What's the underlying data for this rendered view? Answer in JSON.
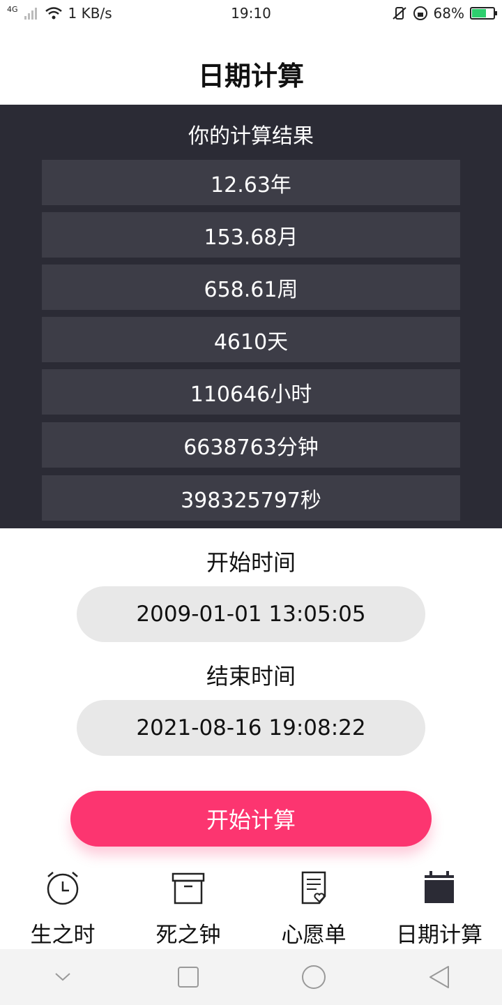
{
  "status_bar": {
    "network": "4G",
    "speed": "1 KB/s",
    "time": "19:10",
    "battery": "68%",
    "battery_level": 0.68
  },
  "page": {
    "title": "日期计算"
  },
  "results": {
    "heading": "你的计算结果",
    "items": [
      "12.63年",
      "153.68月",
      "658.61周",
      "4610天",
      "110646小时",
      "6638763分钟",
      "398325797秒"
    ]
  },
  "start": {
    "label": "开始时间",
    "value": "2009-01-01 13:05:05"
  },
  "end": {
    "label": "结束时间",
    "value": "2021-08-16 19:08:22"
  },
  "calc_button": {
    "label": "开始计算",
    "color": "#fc3570"
  },
  "tabs": [
    {
      "label": "生之时",
      "icon": "alarm-clock-icon"
    },
    {
      "label": "死之钟",
      "icon": "archive-box-icon"
    },
    {
      "label": "心愿单",
      "icon": "wish-list-icon"
    },
    {
      "label": "日期计算",
      "icon": "calendar-icon",
      "active": true
    }
  ],
  "colors": {
    "results_bg": "#2b2b35",
    "result_row_bg": "#3d3d47",
    "pill_bg": "#e8e8e8"
  }
}
